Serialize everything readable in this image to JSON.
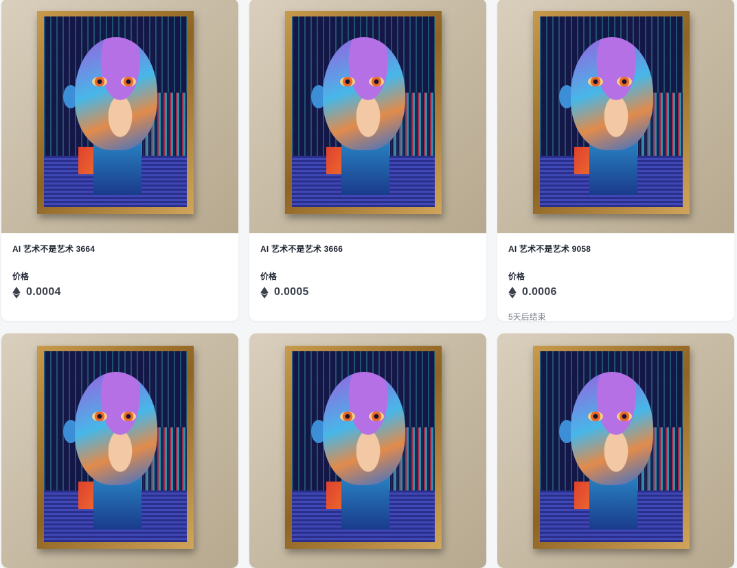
{
  "cards": [
    {
      "title": "AI 艺术不是艺术 3664",
      "price_label": "价格",
      "price": "0.0004",
      "ends": ""
    },
    {
      "title": "AI 艺术不是艺术 3666",
      "price_label": "价格",
      "price": "0.0005",
      "ends": ""
    },
    {
      "title": "AI 艺术不是艺术 9058",
      "price_label": "价格",
      "price": "0.0006",
      "ends": "5天后结束"
    },
    {
      "title": "",
      "price_label": "",
      "price": "",
      "ends": ""
    },
    {
      "title": "",
      "price_label": "",
      "price": "",
      "ends": ""
    },
    {
      "title": "",
      "price_label": "",
      "price": "",
      "ends": ""
    }
  ],
  "currency_icon": "ethereum-icon",
  "colors": {
    "background": "#f5f6f8",
    "card": "#ffffff",
    "title": "#1d2330",
    "price": "#3b414c",
    "muted": "#7a808a"
  }
}
